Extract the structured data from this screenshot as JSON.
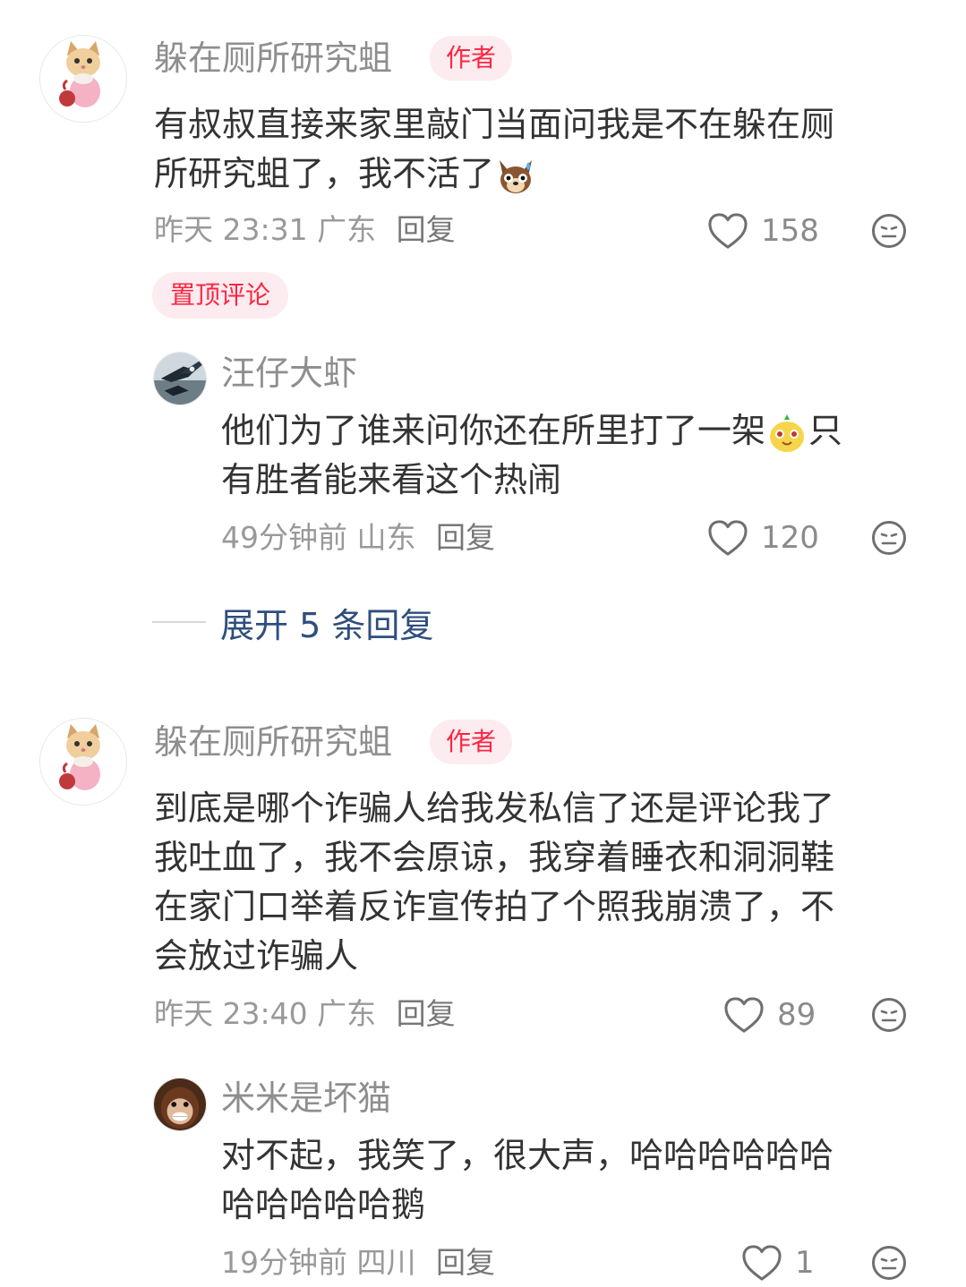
{
  "comments": [
    {
      "author": "躲在厕所研究蛆",
      "badge": "作者",
      "lines": [
        "有叔叔直接来家里敲门当面问我是不在躲在厕",
        "所研究蛆了，我不活了"
      ],
      "time": "昨天 23:31",
      "location": "广东",
      "reply_label": "回复",
      "likes": "158",
      "pinned_label": "置顶评论",
      "trailing_emoji": "sweating-dog-emoji"
    },
    {
      "author": "汪仔大虾",
      "lines_line1": "他们为了谁来问你还在所里打了一架",
      "lines_line1_tail": "只",
      "lines_line2": "有胜者能来看这个热闹",
      "time": "49分钟前",
      "location": "山东",
      "reply_label": "回复",
      "likes": "120",
      "inline_emoji": "yellow-blob-emoji"
    },
    {
      "author": "躲在厕所研究蛆",
      "badge": "作者",
      "lines": [
        "到底是哪个诈骗人给我发私信了还是评论我了",
        "我吐血了，我不会原谅，我穿着睡衣和洞洞鞋",
        "在家门口举着反诈宣传拍了个照我崩溃了，不",
        "会放过诈骗人"
      ],
      "time": "昨天 23:40",
      "location": "广东",
      "reply_label": "回复",
      "likes": "89"
    },
    {
      "author": "米米是坏猫",
      "lines": [
        "对不起，我笑了，很大声，哈哈哈哈哈哈",
        "哈哈哈哈哈鹅"
      ],
      "time": "19分钟前",
      "location": "四川",
      "reply_label": "回复",
      "likes": "1"
    }
  ],
  "expand_replies": "展开 5 条回复",
  "icons": [
    "heart-icon",
    "dislike-face-icon",
    "cat-avatar",
    "bird-avatar",
    "orangutan-avatar"
  ],
  "colors": {
    "accent": "#ff2442",
    "badge_bg": "#fdecef",
    "link": "#2e4e7e",
    "muted": "#999999"
  }
}
